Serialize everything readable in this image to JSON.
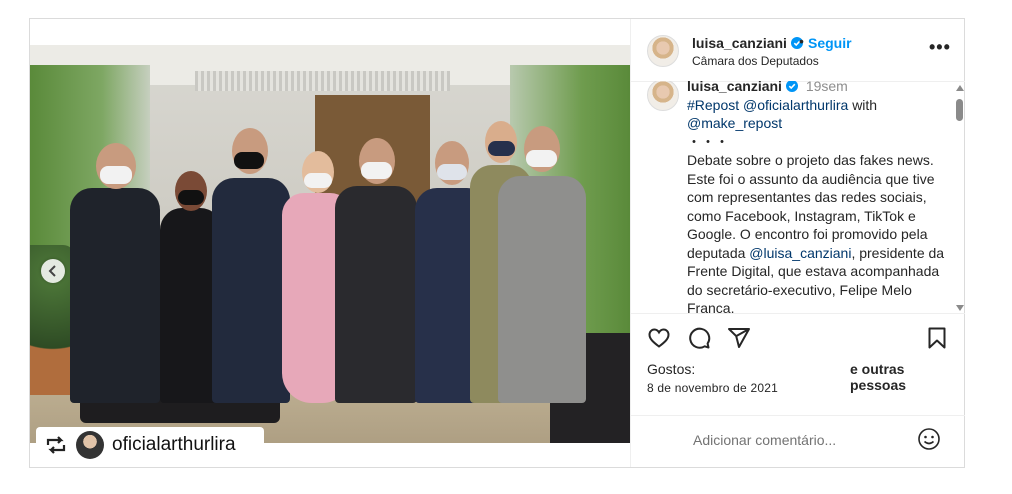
{
  "post": {
    "media": {
      "tag_username": "oficialarthurlira",
      "carousel": {
        "total": 6,
        "active_index": 5
      }
    },
    "header": {
      "username": "luisa_canziani",
      "separator": "•",
      "follow_label": "Seguir",
      "location": "Câmara dos Deputados",
      "more_label": "•••"
    },
    "caption": {
      "username": "luisa_canziani",
      "time": "19sem",
      "repost_tag": "#Repost",
      "mention_1": "@oficialarthurlira",
      "with_text": "with",
      "mention_2": "@make_repost",
      "bullet_line": "・・・",
      "paragraph_1": "Debate sobre o projeto das fakes news. Este foi o assunto da audiência  que tive com representantes  das redes sociais, como Facebook, Instagram, TikTok e Google. O encontro foi promovido pela deputada",
      "mention_3": "@luisa_canziani",
      "paragraph_2": ", presidente da Frente Digital, que estava acompanhada do secretário-executivo, Felipe Melo França."
    },
    "likes": {
      "prefix": "Gostos:",
      "suffix": "e outras pessoas"
    },
    "date": "8 de novembro de 2021",
    "comment": {
      "placeholder": "Adicionar comentário..."
    },
    "icons": {
      "like": "heart-icon",
      "comment": "comment-icon",
      "share": "share-icon",
      "save": "bookmark-icon",
      "emoji": "emoji-icon",
      "verified": "verified-badge-icon",
      "repost": "repost-icon",
      "prev": "chevron-left-icon"
    },
    "colors": {
      "accent": "#0095f6",
      "mention": "#00376b",
      "verified": "#0095f6"
    }
  }
}
